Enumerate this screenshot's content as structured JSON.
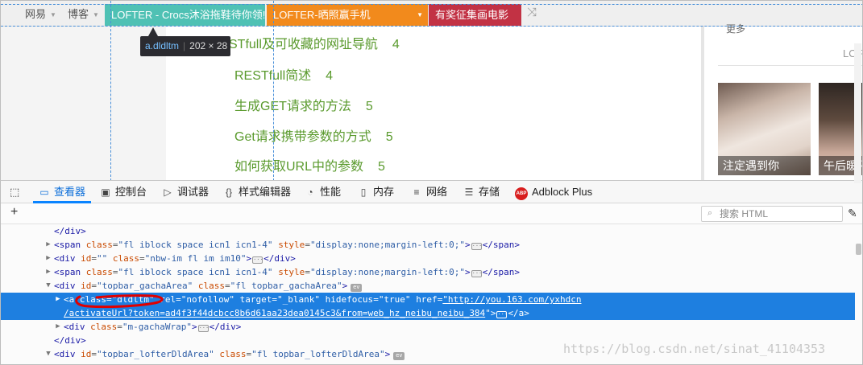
{
  "topbar": {
    "items": [
      {
        "label": "网易"
      },
      {
        "label": "博客"
      }
    ],
    "banners": [
      {
        "label": "LOFTER - Crocs沐浴拖鞋待你领!",
        "color": "#4fc1b4"
      },
      {
        "label": "LOFTER-晒照赢手机",
        "color": "#f28a1c"
      },
      {
        "label": "有奖征集画电影",
        "color": "#c23244"
      }
    ],
    "shuffle_icon": "shuffle-icon"
  },
  "tooltip": {
    "tag": "a.dldltm",
    "dims": "202 × 28"
  },
  "articles": [
    {
      "title": "STfull及可收藏的网址导航",
      "count": "4"
    },
    {
      "title": "RESTfull简述",
      "count": "4"
    },
    {
      "title": "生成GET请求的方法",
      "count": "5"
    },
    {
      "title": "Get请求携带参数的方式",
      "count": "5"
    },
    {
      "title": "如何获取URL中的参数",
      "count": "5"
    }
  ],
  "sidebar": {
    "more_label": "更多",
    "heading": "LOF",
    "thumbs": [
      {
        "caption": "注定遇到你"
      },
      {
        "caption": "午后暖阳"
      }
    ]
  },
  "devtools": {
    "tabs": [
      {
        "label": "查看器",
        "icon": "inspector-icon",
        "active": true
      },
      {
        "label": "控制台",
        "icon": "console-icon"
      },
      {
        "label": "调试器",
        "icon": "debugger-icon"
      },
      {
        "label": "样式编辑器",
        "icon": "style-editor-icon"
      },
      {
        "label": "性能",
        "icon": "performance-icon"
      },
      {
        "label": "内存",
        "icon": "memory-icon"
      },
      {
        "label": "网络",
        "icon": "network-icon"
      },
      {
        "label": "存储",
        "icon": "storage-icon"
      },
      {
        "label": "Adblock Plus",
        "icon": "abp-icon"
      }
    ],
    "search_placeholder": "搜索 HTML",
    "abp_badge": "ABP",
    "event_badge": "ev",
    "markup": {
      "r1": {
        "close": "</div>"
      },
      "r2": {
        "tag": "span",
        "a1": "class",
        "v1": "\"fl iblock space icn1 icn1-4\"",
        "a2": "style",
        "v2": "\"display:none;margin-left:0;\"",
        "close": "</span>"
      },
      "r3": {
        "tag": "div",
        "a1": "id",
        "v1": "\"\"",
        "a2": "class",
        "v2": "\"nbw-im fl im im10\"",
        "close": "</div>"
      },
      "r4": {
        "tag": "span",
        "a1": "class",
        "v1": "\"fl iblock space icn1 icn1-4\"",
        "a2": "style",
        "v2": "\"display:none;margin-left:0;\"",
        "close": "</span>"
      },
      "r5": {
        "tag": "div",
        "a1": "id",
        "v1": "\"topbar_gachaArea\"",
        "a2": "class",
        "v2": "\"fl topbar_gachaArea\""
      },
      "r6": {
        "tag": "a",
        "a1": "class",
        "v1": "\"dldltm\"",
        "a2": "rel",
        "v2": "\"nofollow\"",
        "a3": "target",
        "v3": "\"_blank\"",
        "a4": "hidefocus",
        "v4": "\"true\"",
        "a5": "href",
        "link1": "\"http://you.163.com/yxhdcn",
        "link2": "/activateUrl?token=ad4f3f44dcbcc8b6d61aa23dea0145c3&from=web_hz_neibu_neibu_384",
        "q": "\"",
        "close": "</a>"
      },
      "r8": {
        "tag": "div",
        "a1": "class",
        "v1": "\"m-gachaWrap\"",
        "close": "</div>"
      },
      "r9": {
        "close": "</div>"
      },
      "r10": {
        "tag": "div",
        "a1": "id",
        "v1": "\"topbar_lofterDldArea\"",
        "a2": "class",
        "v2": "\"fl topbar_lofterDldArea\""
      }
    }
  },
  "watermark": "https://blog.csdn.net/sinat_41104353",
  "colors": {
    "link_green": "#5a9a2d",
    "selection_blue": "#1e7fe0",
    "active_tab": "#0a6dd9",
    "annotation_red": "#e00000"
  }
}
